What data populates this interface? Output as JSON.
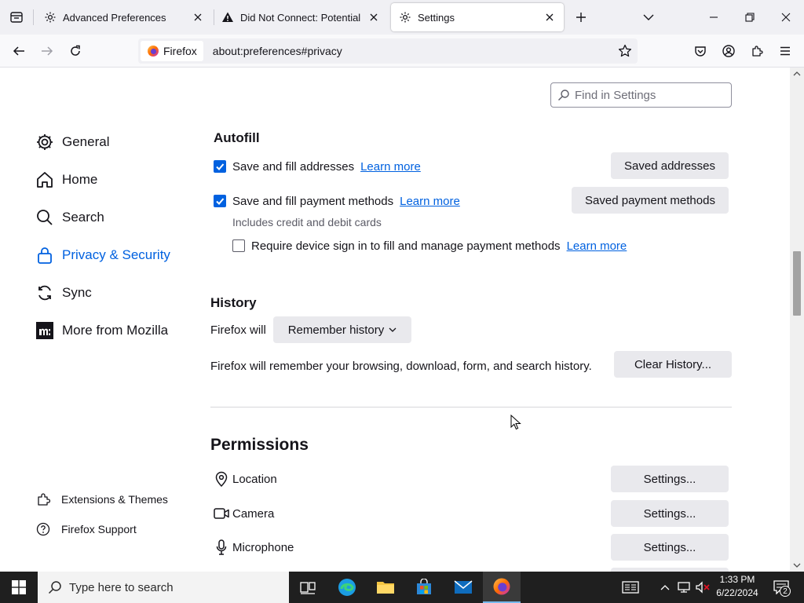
{
  "browser": {
    "tabs": [
      {
        "title": "Advanced Preferences",
        "icon": "gear-icon",
        "active": false
      },
      {
        "title": "Did Not Connect: Potential Security Issue",
        "icon": "warning-icon",
        "active": false
      },
      {
        "title": "Settings",
        "icon": "gear-icon",
        "active": true
      }
    ],
    "identity_label": "Firefox",
    "url": "about:preferences#privacy"
  },
  "settings": {
    "search_placeholder": "Find in Settings",
    "categories": [
      {
        "label": "General",
        "icon": "gear-icon"
      },
      {
        "label": "Home",
        "icon": "home-icon"
      },
      {
        "label": "Search",
        "icon": "search-icon"
      },
      {
        "label": "Privacy & Security",
        "icon": "lock-icon",
        "selected": true
      },
      {
        "label": "Sync",
        "icon": "sync-icon"
      },
      {
        "label": "More from Mozilla",
        "icon": "mozilla-icon"
      }
    ],
    "footer_links": [
      {
        "label": "Extensions & Themes",
        "icon": "puzzle-icon"
      },
      {
        "label": "Firefox Support",
        "icon": "help-icon"
      }
    ],
    "autofill": {
      "heading": "Autofill",
      "addresses_label": "Save and fill addresses",
      "addresses_checked": true,
      "payments_label": "Save and fill payment methods",
      "payments_checked": true,
      "payments_sub": "Includes credit and debit cards",
      "device_signin_label": "Require device sign in to fill and manage payment methods",
      "device_signin_checked": false,
      "learn_more": "Learn more",
      "saved_addresses_button": "Saved addresses",
      "saved_payments_button": "Saved payment methods"
    },
    "history": {
      "heading": "History",
      "firefox_will": "Firefox will",
      "mode": "Remember history",
      "description": "Firefox will remember your browsing, download, form, and search history.",
      "clear_button": "Clear History..."
    },
    "permissions": {
      "heading": "Permissions",
      "items": [
        {
          "label": "Location",
          "icon": "location-icon",
          "button": "Settings..."
        },
        {
          "label": "Camera",
          "icon": "camera-icon",
          "button": "Settings..."
        },
        {
          "label": "Microphone",
          "icon": "microphone-icon",
          "button": "Settings..."
        }
      ]
    }
  },
  "taskbar": {
    "search_placeholder": "Type here to search",
    "time": "1:33 PM",
    "date": "6/22/2024",
    "notification_count": "2"
  },
  "colors": {
    "accent": "#0061e0",
    "taskbar": "#1f1f1f"
  }
}
